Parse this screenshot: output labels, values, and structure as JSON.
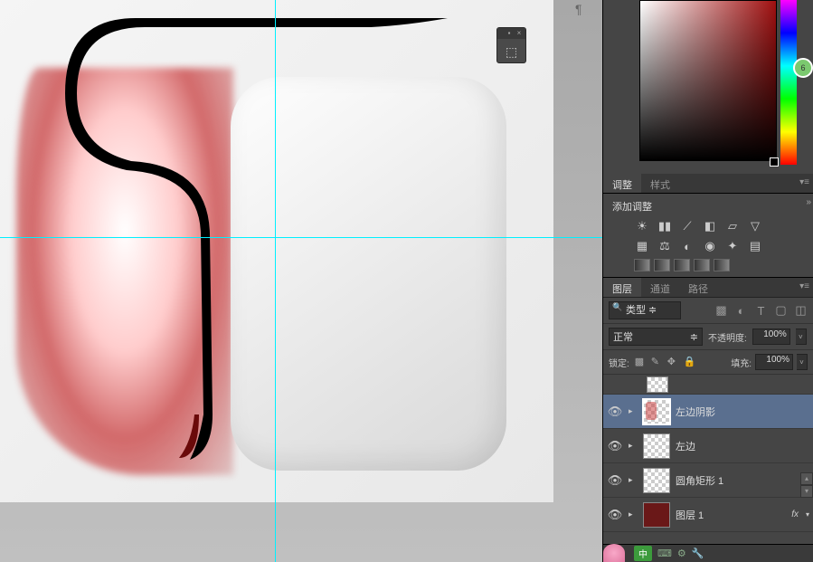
{
  "mini_panel": {
    "icon": "⬚"
  },
  "adjustments": {
    "tab_adjust": "调整",
    "tab_style": "样式",
    "add_label": "添加调整"
  },
  "layers_panel": {
    "tab_layers": "图层",
    "tab_channels": "通道",
    "tab_paths": "路径",
    "filter_kind": "类型",
    "blend_mode": "正常",
    "opacity_label": "不透明度:",
    "opacity_value": "100%",
    "lock_label": "锁定:",
    "fill_label": "填充:",
    "fill_value": "100%"
  },
  "layers": [
    {
      "name": "左边阴影",
      "visible": true,
      "selected": true,
      "expandable": true,
      "thumb": "checker-shadow"
    },
    {
      "name": "左边",
      "visible": true,
      "selected": false,
      "expandable": true,
      "thumb": "checker"
    },
    {
      "name": "圆角矩形 1",
      "visible": true,
      "selected": false,
      "expandable": true,
      "thumb": "checker"
    },
    {
      "name": "图层 1",
      "visible": true,
      "selected": false,
      "expandable": true,
      "thumb": "red",
      "fx": true
    }
  ],
  "fx_label": "fx",
  "status": {
    "ime": "中"
  },
  "circle_badge": "6"
}
